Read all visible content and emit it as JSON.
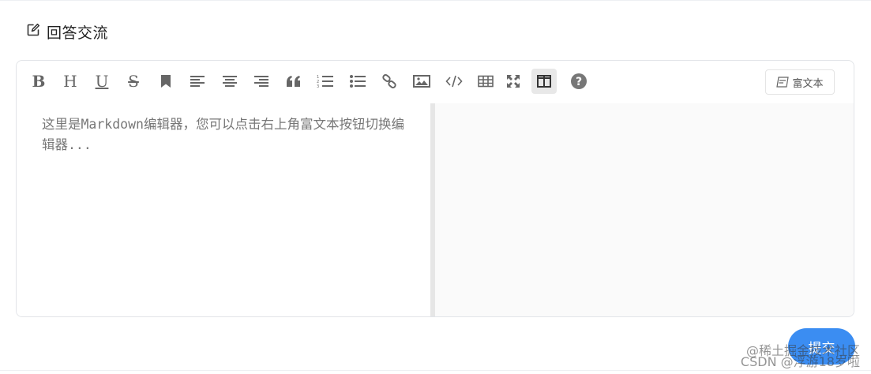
{
  "section": {
    "title": "回答交流",
    "icon": "edit-icon"
  },
  "toolbar": {
    "items": [
      {
        "name": "bold",
        "text": "B"
      },
      {
        "name": "heading",
        "text": "H"
      },
      {
        "name": "underline",
        "text": "U"
      },
      {
        "name": "strikethrough",
        "text": "S"
      },
      {
        "name": "bookmark",
        "icon": "bookmark-icon"
      },
      {
        "name": "align-left",
        "icon": "align-left-icon"
      },
      {
        "name": "align-center",
        "icon": "align-center-icon"
      },
      {
        "name": "align-right",
        "icon": "align-right-icon"
      },
      {
        "name": "quote",
        "icon": "quote-icon"
      },
      {
        "name": "ordered-list",
        "icon": "ordered-list-icon"
      },
      {
        "name": "unordered-list",
        "icon": "unordered-list-icon"
      },
      {
        "name": "link",
        "icon": "link-icon"
      },
      {
        "name": "image",
        "icon": "image-icon"
      },
      {
        "name": "code",
        "icon": "code-icon"
      },
      {
        "name": "table",
        "icon": "table-icon"
      },
      {
        "name": "fullscreen",
        "icon": "fullscreen-icon"
      },
      {
        "name": "split-view",
        "icon": "split-view-icon",
        "active": true
      },
      {
        "name": "help",
        "icon": "help-icon"
      }
    ],
    "richtext_label": "富文本"
  },
  "editor": {
    "placeholder": "这里是Markdown编辑器，您可以点击右上角富文本按钮切换编辑器..."
  },
  "submit_label": "提交",
  "watermark": {
    "line1": "@稀土掘金技术社区",
    "line2": "CSDN @浮游18岁啦"
  },
  "colors": {
    "accent": "#3b8df2",
    "icon": "#666666",
    "active_bg": "#e8e8e8"
  }
}
